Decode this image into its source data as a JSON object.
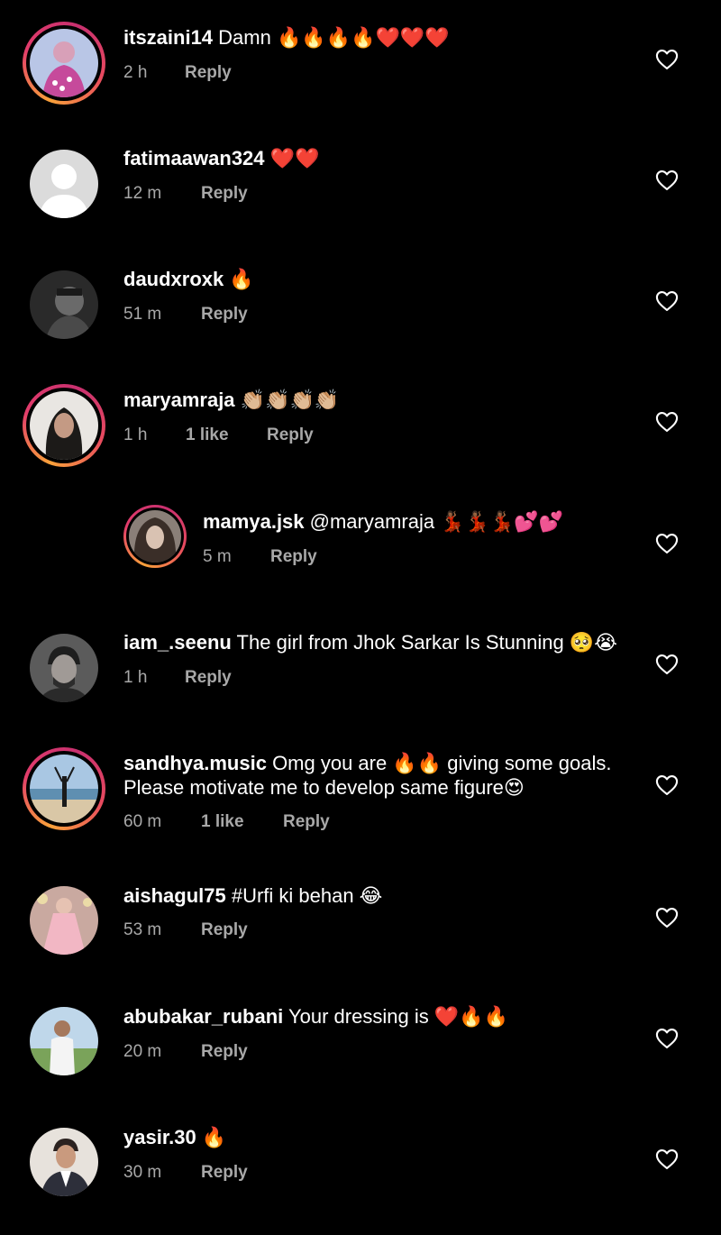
{
  "comments": [
    {
      "username": "itszaini14",
      "text": " Damn 🔥🔥🔥🔥❤️❤️❤️",
      "time": "2 h",
      "likes": "",
      "reply": "Reply"
    },
    {
      "username": "fatimaawan324",
      "text": " ❤️❤️",
      "time": "12 m",
      "likes": "",
      "reply": "Reply"
    },
    {
      "username": "daudxroxk",
      "text": " 🔥",
      "time": "51 m",
      "likes": "",
      "reply": "Reply"
    },
    {
      "username": "maryamraja",
      "text": " 👏🏼👏🏼👏🏼👏🏼",
      "time": "1 h",
      "likes": "1 like",
      "reply": "Reply"
    },
    {
      "username": "mamya.jsk",
      "text": " @maryamraja 💃🏾💃🏾💃🏾💕💕",
      "time": "5 m",
      "likes": "",
      "reply": "Reply"
    },
    {
      "username": "iam_.seenu",
      "text": " The girl from Jhok Sarkar Is Stunning 🥺😭",
      "time": "1 h",
      "likes": "",
      "reply": "Reply"
    },
    {
      "username": "sandhya.music",
      "text": " Omg you are 🔥🔥 giving some goals.",
      "text2": "Please motivate me to develop same figure😍",
      "time": "60 m",
      "likes": "1 like",
      "reply": "Reply"
    },
    {
      "username": "aishagul75",
      "text": " #Urfi ki behan 😂",
      "time": "53 m",
      "likes": "",
      "reply": "Reply"
    },
    {
      "username": "abubakar_rubani",
      "text": " Your dressing is ❤️🔥🔥",
      "time": "20 m",
      "likes": "",
      "reply": "Reply"
    },
    {
      "username": "yasir.30",
      "text": " 🔥",
      "time": "30 m",
      "likes": "",
      "reply": "Reply"
    }
  ],
  "icons": {
    "like": "heart-outline-icon",
    "default_avatar": "person-silhouette-icon"
  },
  "colors": {
    "background": "#000000",
    "text": "#ffffff",
    "meta": "#a8a8a8",
    "story_ring_start": "#f9a13a",
    "story_ring_end": "#c8306f"
  }
}
